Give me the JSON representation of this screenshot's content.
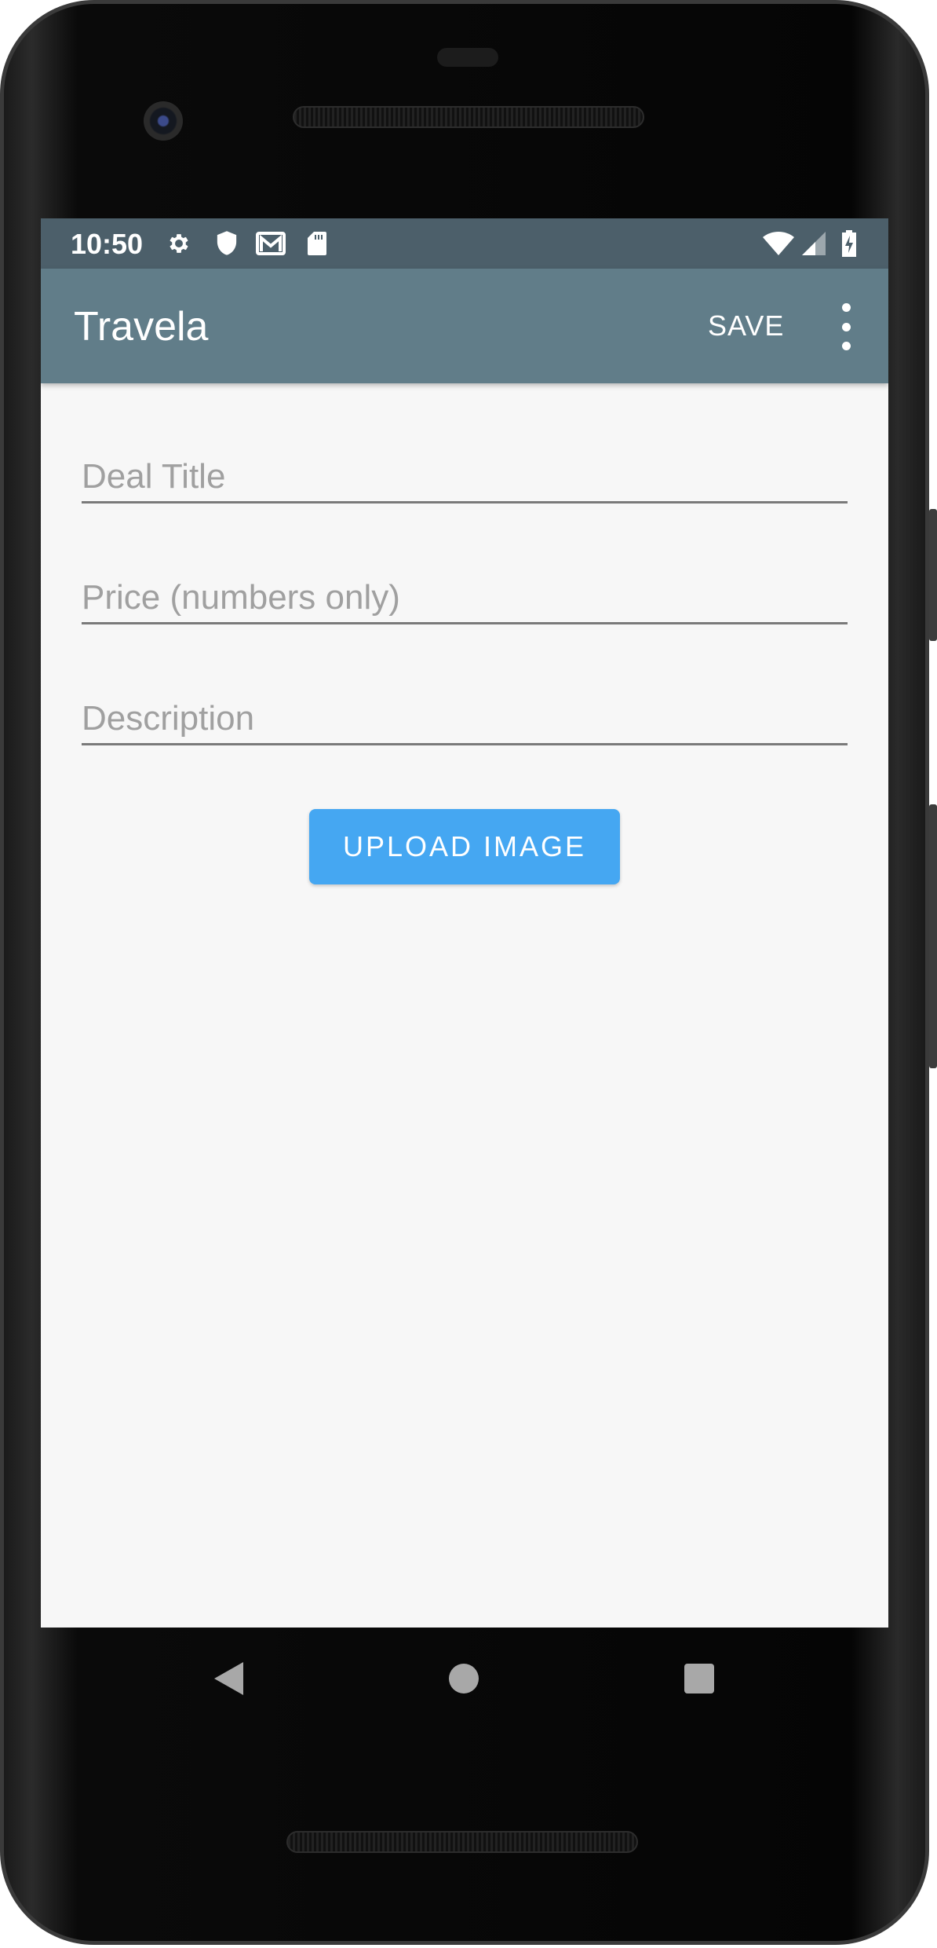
{
  "status_bar": {
    "time": "10:50",
    "left_icons": [
      "settings-icon",
      "shield-icon",
      "gmail-icon",
      "sd-card-icon"
    ],
    "right_icons": [
      "wifi-icon",
      "signal-icon",
      "battery-charging-icon"
    ]
  },
  "app_bar": {
    "title": "Travela",
    "save_label": "SAVE",
    "overflow_icon": "more-vert-icon",
    "color": "#617d89"
  },
  "form": {
    "deal_title": {
      "value": "",
      "placeholder": "Deal Title"
    },
    "price": {
      "value": "",
      "placeholder": "Price (numbers only)"
    },
    "description": {
      "value": "",
      "placeholder": "Description"
    },
    "upload_label": "UPLOAD IMAGE",
    "upload_color": "#45a7f2"
  },
  "nav_bar": {
    "back_icon": "back-triangle-icon",
    "home_icon": "home-circle-icon",
    "recents_icon": "recents-square-icon"
  }
}
